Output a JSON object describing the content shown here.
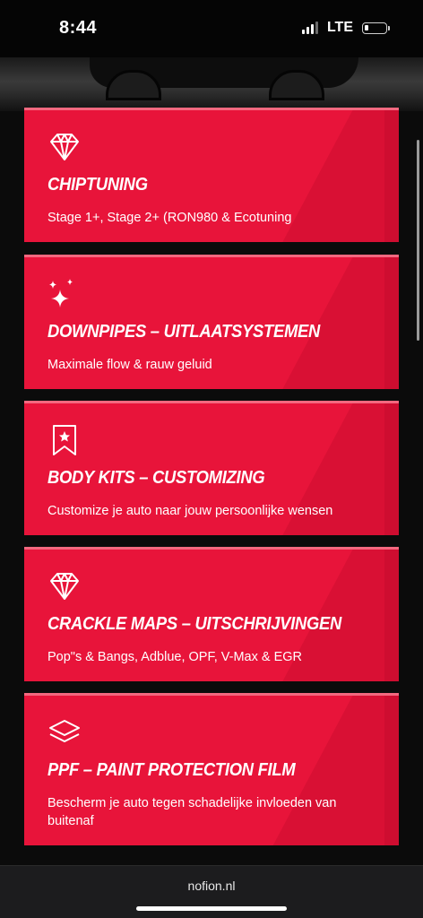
{
  "status": {
    "time": "8:44",
    "network": "LTE",
    "signal_bars": 3,
    "battery_level": 0.2
  },
  "colors": {
    "card_bg": "#e8143a",
    "card_top_border": "#f3687f",
    "page_bg": "#0b0b0b"
  },
  "services": [
    {
      "icon": "diamond-icon",
      "title": "CHIPTUNING",
      "description": "Stage 1+, Stage 2+ (RON980 & Ecotuning"
    },
    {
      "icon": "sparkles-icon",
      "title": "DOWNPIPES – UITLAATSYSTEMEN",
      "description": "Maximale flow & rauw geluid"
    },
    {
      "icon": "bookmark-star-icon",
      "title": "BODY KITS – CUSTOMIZING",
      "description": "Customize je auto naar jouw persoonlijke wensen"
    },
    {
      "icon": "diamond-icon",
      "title": "CRACKLE MAPS – UITSCHRIJVINGEN",
      "description": "Pop\"s & Bangs, Adblue, OPF, V-Max & EGR"
    },
    {
      "icon": "layers-icon",
      "title": "PPF – PAINT PROTECTION FILM",
      "description": "Bescherm je auto tegen schadelijke invloeden van buitenaf"
    }
  ],
  "browser": {
    "url": "nofion.nl"
  }
}
